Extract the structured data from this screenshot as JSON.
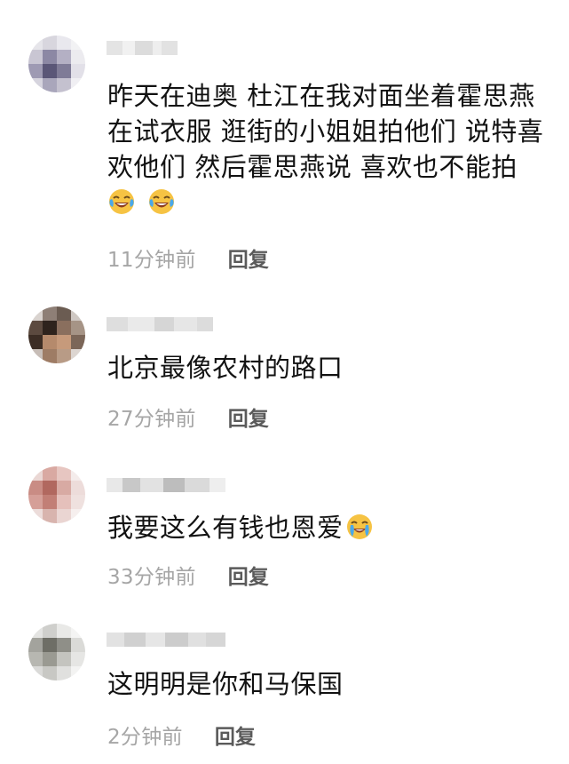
{
  "comments": [
    {
      "text_lines": [
        "昨天在迪奥 杜江在我对面坐着霍思燕",
        "在试衣服 逛街的小姐姐拍他们 说特喜",
        "欢他们 然后霍思燕说 喜欢也不能拍"
      ],
      "emojis": [
        "laughing-tears-emoji",
        "laughing-tears-emoji"
      ],
      "time": "11分钟前",
      "reply_label": "回复"
    },
    {
      "text": "北京最像农村的路口",
      "time": "27分钟前",
      "reply_label": "回复"
    },
    {
      "text": "我要这么有钱也恩爱",
      "emojis": [
        "crying-laughing-emoji"
      ],
      "time": "33分钟前",
      "reply_label": "回复"
    },
    {
      "text": "这明明是你和马保国",
      "time": "2分钟前",
      "reply_label": "回复"
    }
  ],
  "colors": {
    "timestamp": "#a6a6a6",
    "reply": "#5a5a5a",
    "text": "#121212",
    "emoji_face": "#f6c343"
  }
}
